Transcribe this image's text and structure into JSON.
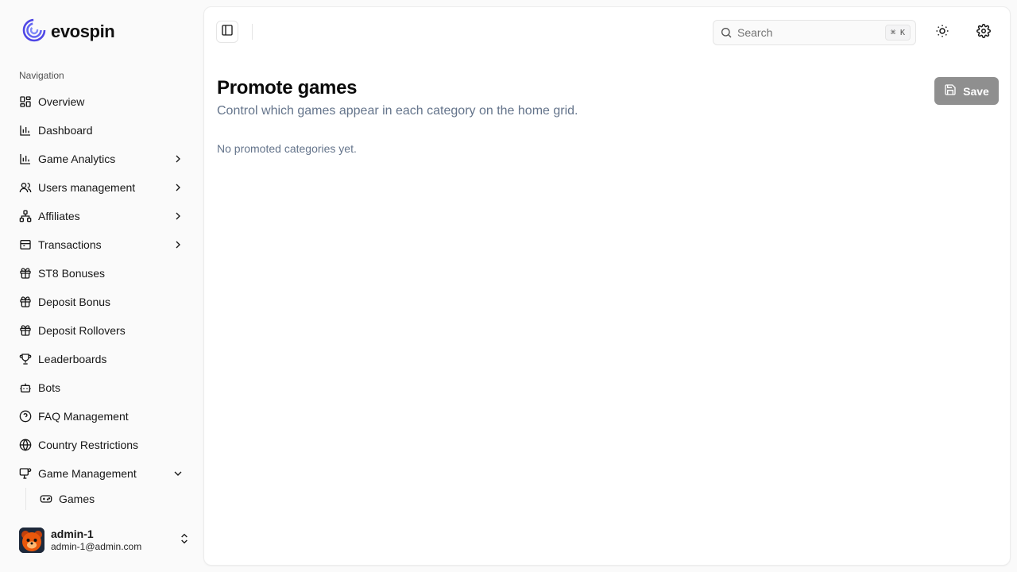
{
  "brand": {
    "name": "evospin"
  },
  "sidebar": {
    "group_label": "Navigation",
    "items": [
      {
        "label": "Overview"
      },
      {
        "label": "Dashboard"
      },
      {
        "label": "Game Analytics"
      },
      {
        "label": "Users management"
      },
      {
        "label": "Affiliates"
      },
      {
        "label": "Transactions"
      },
      {
        "label": "ST8 Bonuses"
      },
      {
        "label": "Deposit Bonus"
      },
      {
        "label": "Deposit Rollovers"
      },
      {
        "label": "Leaderboards"
      },
      {
        "label": "Bots"
      },
      {
        "label": "FAQ Management"
      },
      {
        "label": "Country Restrictions"
      },
      {
        "label": "Game Management"
      }
    ],
    "sub_items": [
      {
        "label": "Games"
      }
    ]
  },
  "user": {
    "name": "admin-1",
    "email": "admin-1@admin.com"
  },
  "header": {
    "search_placeholder": "Search",
    "shortcut": "⌘ K"
  },
  "page": {
    "title": "Promote games",
    "subtitle": "Control which games appear in each category on the home grid.",
    "empty_text": "No promoted categories yet.",
    "save_label": "Save"
  }
}
